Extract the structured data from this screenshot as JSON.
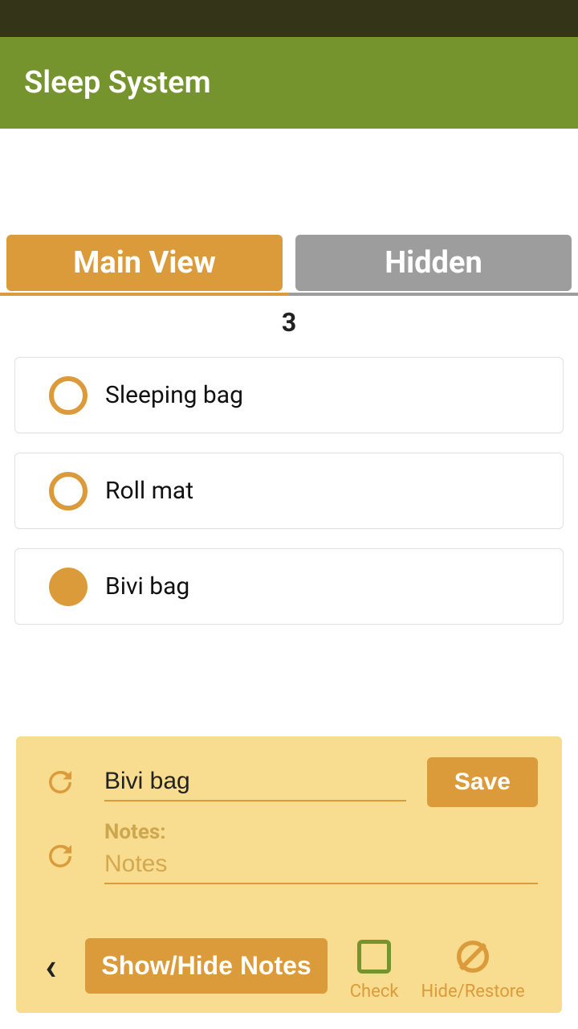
{
  "header": {
    "title": "Sleep System"
  },
  "tabs": {
    "main": "Main View",
    "hidden": "Hidden",
    "active": "main"
  },
  "count": "3",
  "items": [
    {
      "label": "Sleeping bag",
      "filled": false
    },
    {
      "label": "Roll mat",
      "filled": false
    },
    {
      "label": "Bivi bag",
      "filled": true
    }
  ],
  "panel": {
    "name_value": "Bivi bag",
    "notes_label": "Notes:",
    "notes_placeholder": "Notes",
    "save": "Save",
    "show_hide": "Show/Hide Notes",
    "check": "Check",
    "hide_restore": "Hide/Restore"
  }
}
